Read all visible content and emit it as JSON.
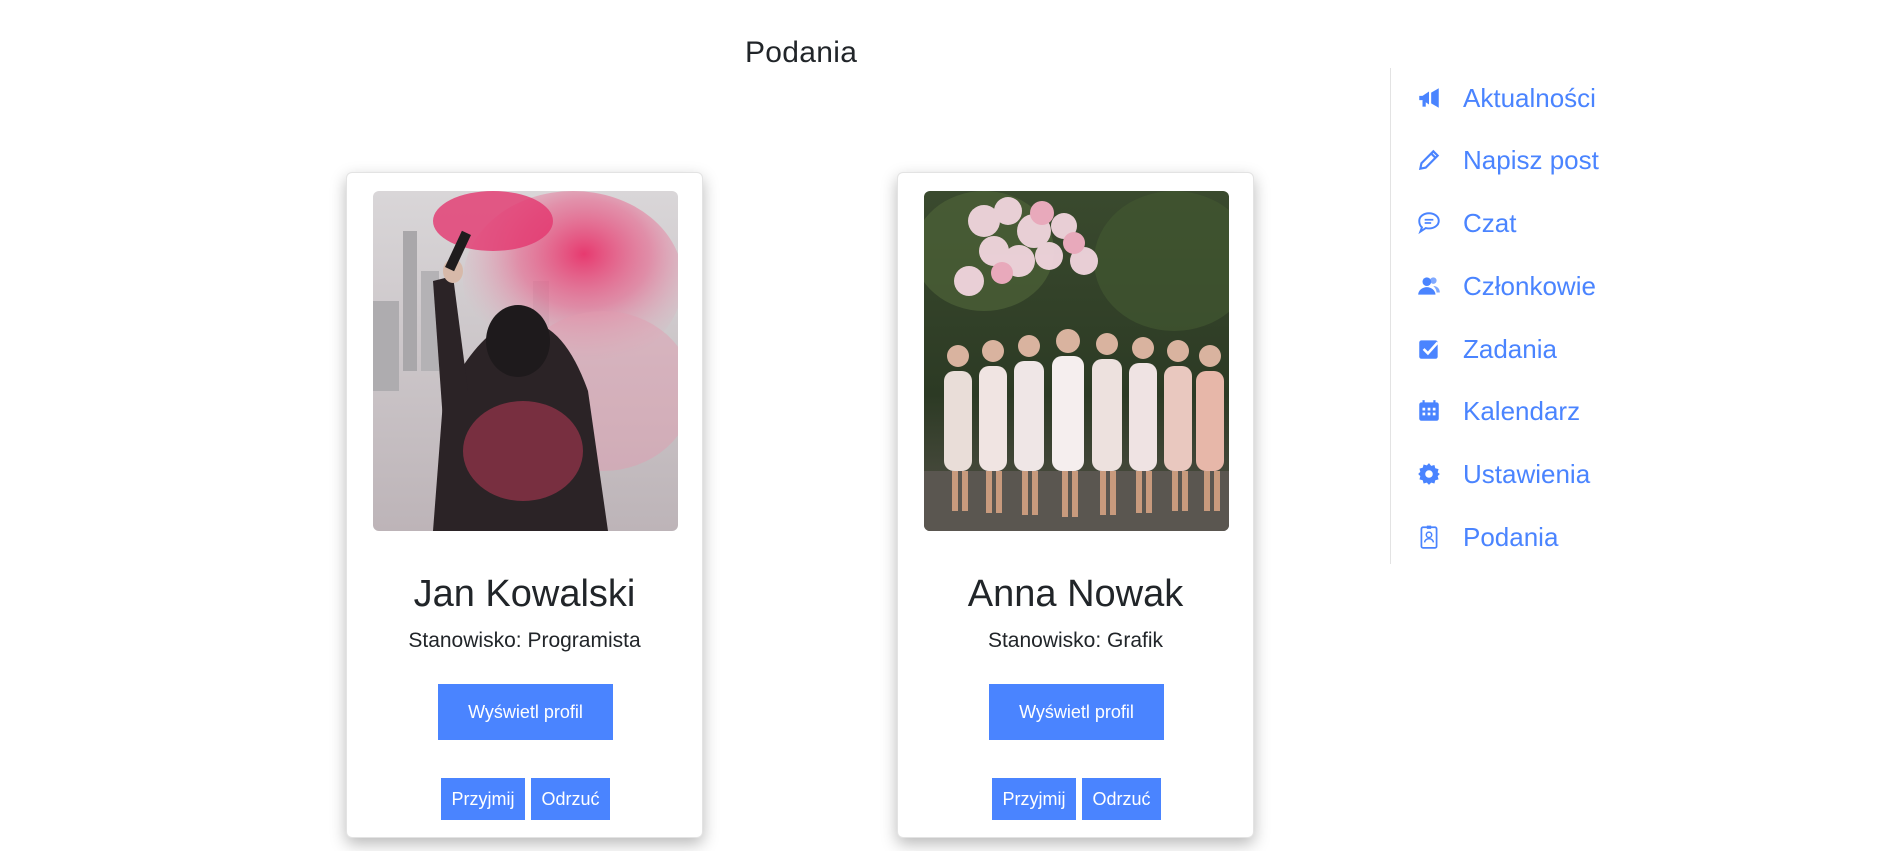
{
  "page": {
    "title": "Podania"
  },
  "theme": {
    "accent": "#4a84ff",
    "text": "#212529"
  },
  "applications": [
    {
      "photo": "person-holding-red-smoke-flare",
      "name": "Jan Kowalski",
      "role_label": "Stanowisko:",
      "role_value": "Programista",
      "profile_button": "Wyświetl profil",
      "accept_button": "Przyjmij",
      "reject_button": "Odrzuć"
    },
    {
      "photo": "group-of-women-with-balloons",
      "name": "Anna Nowak",
      "role_label": "Stanowisko:",
      "role_value": "Grafik",
      "profile_button": "Wyświetl profil",
      "accept_button": "Przyjmij",
      "reject_button": "Odrzuć"
    }
  ],
  "sidebar": {
    "items": [
      {
        "label": "Aktualności",
        "icon": "megaphone-icon"
      },
      {
        "label": "Napisz post",
        "icon": "pencil-icon"
      },
      {
        "label": "Czat",
        "icon": "chat-bubble-icon"
      },
      {
        "label": "Członkowie",
        "icon": "users-icon"
      },
      {
        "label": "Zadania",
        "icon": "checkbox-icon"
      },
      {
        "label": "Kalendarz",
        "icon": "calendar-icon"
      },
      {
        "label": "Ustawienia",
        "icon": "gear-icon"
      },
      {
        "label": "Podania",
        "icon": "id-badge-icon"
      }
    ]
  }
}
